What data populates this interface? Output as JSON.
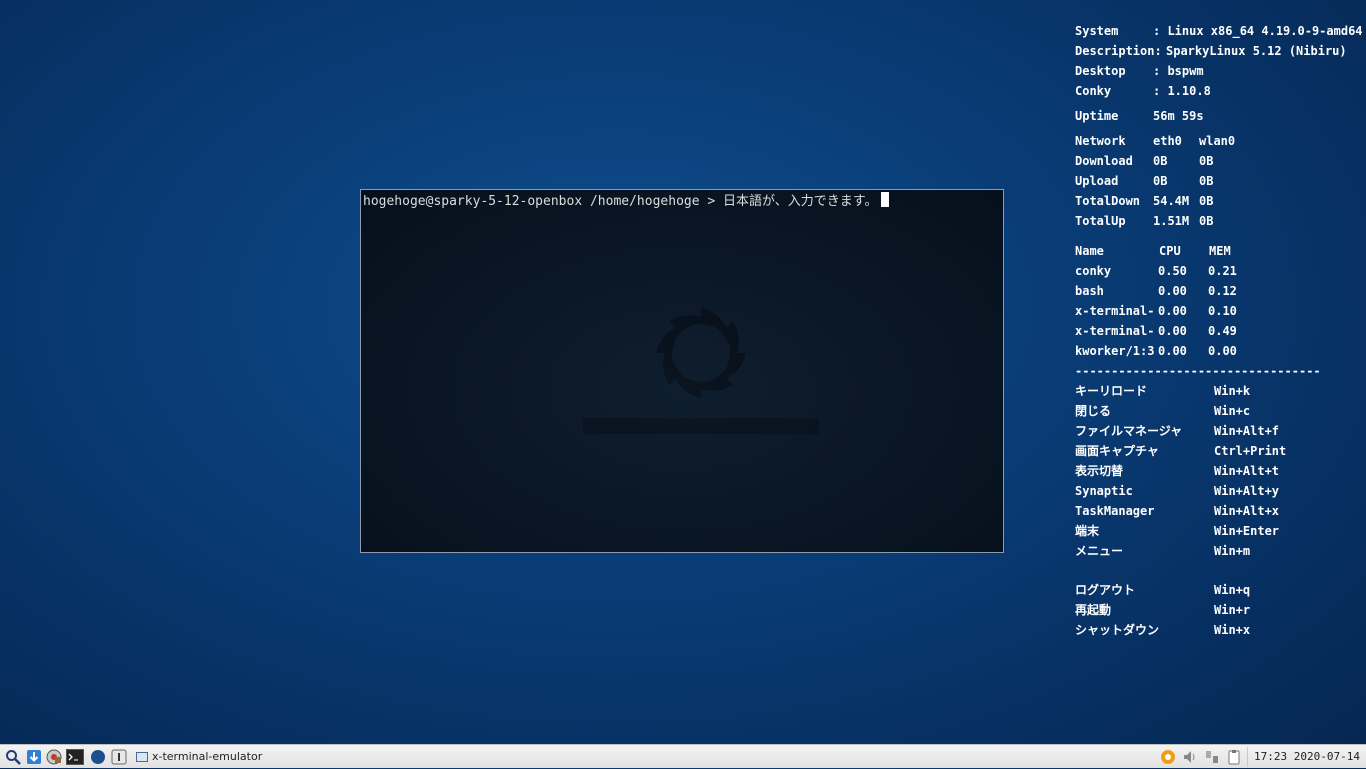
{
  "terminal": {
    "prompt": "hogehoge@sparky-5-12-openbox /home/hogehoge > ",
    "input": "日本語が、入力できます。"
  },
  "conky": {
    "system_label": "System",
    "system_value": ": Linux x86_64 4.19.0-9-amd64",
    "desc_label": "Description:",
    "desc_value": "SparkyLinux 5.12 (Nibiru)",
    "desktop_label": "Desktop",
    "desktop_value": ": bspwm",
    "conky_label": "Conky",
    "conky_value": ": 1.10.8",
    "uptime_label": "Uptime",
    "uptime_value": "56m 59s",
    "network": {
      "headers": [
        "Network",
        "eth0",
        "wlan0"
      ],
      "rows": [
        [
          "Download",
          "0B",
          "0B"
        ],
        [
          "Upload",
          "0B",
          "0B"
        ],
        [
          "TotalDown",
          "54.4M",
          "0B"
        ],
        [
          "TotalUp",
          "1.51M",
          "0B"
        ]
      ]
    },
    "processes": {
      "headers": [
        "Name",
        "CPU",
        "MEM"
      ],
      "rows": [
        [
          "conky",
          "0.50",
          "0.21"
        ],
        [
          "bash",
          "0.00",
          "0.12"
        ],
        [
          "x-terminal-",
          "0.00",
          "0.10"
        ],
        [
          "x-terminal-",
          "0.00",
          "0.49"
        ],
        [
          "kworker/1:3",
          "0.00",
          "0.00"
        ]
      ]
    },
    "separator": "----------------------------------",
    "shortcuts": [
      [
        "キーリロード",
        "Win+k"
      ],
      [
        "閉じる",
        "Win+c"
      ],
      [
        "ファイルマネージャ",
        "Win+Alt+f"
      ],
      [
        "画面キャプチャ",
        "Ctrl+Print"
      ],
      [
        "表示切替",
        "Win+Alt+t"
      ],
      [
        "Synaptic",
        "Win+Alt+y"
      ],
      [
        "TaskManager",
        "Win+Alt+x"
      ],
      [
        "端末",
        "Win+Enter"
      ],
      [
        "メニュー",
        "Win+m"
      ]
    ],
    "session": [
      [
        "ログアウト",
        "Win+q"
      ],
      [
        "再起動",
        "Win+r"
      ],
      [
        "シャットダウン",
        "Win+x"
      ]
    ]
  },
  "taskbar": {
    "task_label": "x-terminal-emulator",
    "clock": "17:23 2020-07-14",
    "launchers": [
      "search-icon",
      "download-icon",
      "package-icon",
      "terminal-icon",
      "browser-icon",
      "power-icon"
    ]
  }
}
